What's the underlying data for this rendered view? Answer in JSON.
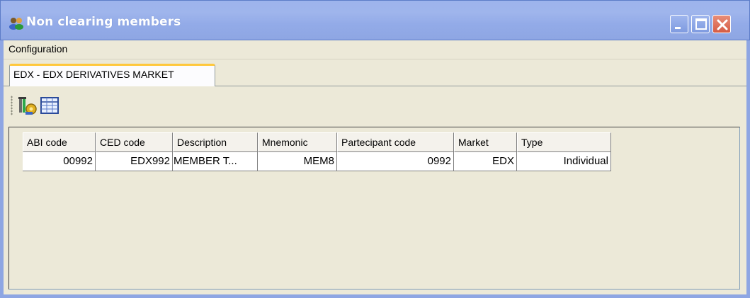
{
  "window": {
    "title": "Non clearing members",
    "colors": {
      "titlebar": "#9fb5ec",
      "client": "#ece9d8",
      "tab_accent": "#ffc83c"
    }
  },
  "menu": {
    "items": [
      {
        "label": "Configuration"
      }
    ]
  },
  "tabs": [
    {
      "label": "EDX -  EDX DERIVATIVES MARKET",
      "active": true
    }
  ],
  "toolbar": {
    "icons": [
      "settings-tool-icon",
      "grid-view-icon"
    ]
  },
  "grid": {
    "columns": [
      "ABI code",
      "CED code",
      "Description",
      "Mnemonic",
      "Partecipant code",
      "Market",
      "Type"
    ],
    "rows": [
      [
        "00992",
        "EDX992",
        "MEMBER T...",
        "MEM8",
        "0992",
        "EDX",
        "Individual"
      ]
    ]
  }
}
